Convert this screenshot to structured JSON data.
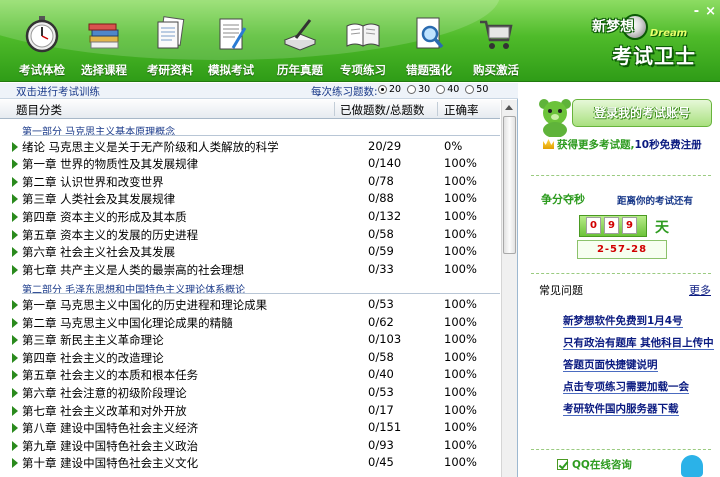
{
  "toolbar": {
    "items": [
      {
        "label": "考试体检",
        "icon": "stopwatch-icon"
      },
      {
        "label": "选择课程",
        "icon": "books-icon"
      },
      {
        "label": "考研资料",
        "icon": "documents-icon"
      },
      {
        "label": "模拟考试",
        "icon": "exam-paper-icon"
      },
      {
        "label": "历年真题",
        "icon": "book-pen-icon"
      },
      {
        "label": "专项练习",
        "icon": "open-book-icon"
      },
      {
        "label": "错题强化",
        "icon": "magnifier-paper-icon"
      },
      {
        "label": "购买激活",
        "icon": "shopping-cart-icon"
      }
    ],
    "minimize": "-",
    "close": "×"
  },
  "logo": {
    "line1": "新梦想",
    "line2": "考试卫士",
    "badge": "Dream"
  },
  "list_panel": {
    "hint": "双击进行考试训练",
    "count_label": "每次练习题数:",
    "count_options": [
      "20",
      "30",
      "40",
      "50"
    ],
    "selected_count": "20",
    "columns": [
      "题目分类",
      "已做题数/总题数",
      "正确率"
    ],
    "sections": [
      {
        "title": "第一部分  马克思主义基本原理概念",
        "rows": [
          {
            "name": "绪论  马克思主义是关于无产阶级和人类解放的科学",
            "count": "20/29",
            "rate": "0%"
          },
          {
            "name": "第一章  世界的物质性及其发展规律",
            "count": "0/140",
            "rate": "100%"
          },
          {
            "name": "第二章  认识世界和改变世界",
            "count": "0/78",
            "rate": "100%"
          },
          {
            "name": "第三章  人类社会及其发展规律",
            "count": "0/88",
            "rate": "100%"
          },
          {
            "name": "第四章  资本主义的形成及其本质",
            "count": "0/132",
            "rate": "100%"
          },
          {
            "name": "第五章  资本主义的发展的历史进程",
            "count": "0/58",
            "rate": "100%"
          },
          {
            "name": "第六章  社会主义社会及其发展",
            "count": "0/59",
            "rate": "100%"
          },
          {
            "name": "第七章  共产主义是人类的最崇高的社会理想",
            "count": "0/33",
            "rate": "100%"
          }
        ]
      },
      {
        "title": "第二部分  毛泽东思想和中国特色主义理论体系概论",
        "rows": [
          {
            "name": "第一章  马克思主义中国化的历史进程和理论成果",
            "count": "0/53",
            "rate": "100%"
          },
          {
            "name": "第二章  马克思主义中国化理论成果的精髓",
            "count": "0/62",
            "rate": "100%"
          },
          {
            "name": "第三章  新民主主义革命理论",
            "count": "0/103",
            "rate": "100%"
          },
          {
            "name": "第四章  社会主义的改造理论",
            "count": "0/58",
            "rate": "100%"
          },
          {
            "name": "第五章  社会主义的本质和根本任务",
            "count": "0/40",
            "rate": "100%"
          },
          {
            "name": "第六章  社会注意的初级阶段理论",
            "count": "0/53",
            "rate": "100%"
          },
          {
            "name": "第七章  社会主义改革和对外开放",
            "count": "0/17",
            "rate": "100%"
          },
          {
            "name": "第八章  建设中国特色社会主义经济",
            "count": "0/151",
            "rate": "100%"
          },
          {
            "name": "第九章  建设中国特色社会主义政治",
            "count": "0/93",
            "rate": "100%"
          },
          {
            "name": "第十章  建设中国特色社会主义文化",
            "count": "0/45",
            "rate": "100%"
          }
        ]
      }
    ]
  },
  "side_panel": {
    "login_label": "登录我的考试账号",
    "promo_green": "获得更多考试题,",
    "promo_blue": "10秒免费注册",
    "countdown_title": "争分夺秒",
    "countdown_sub": "距离你的考试还有",
    "days_digits": [
      "0",
      "9",
      "9"
    ],
    "days_unit": "天",
    "time_left": "2-57-28",
    "faq_title": "常见问题",
    "faq_more": "更多",
    "faq_items": [
      "新梦想软件免费到1月4号",
      "只有政治有题库 其他科目上传中",
      "答题页面快捷键说明",
      "点击专项练习需要加载一会",
      "考研软件国内服务器下载"
    ],
    "qq_label": "QQ在线咨询"
  }
}
